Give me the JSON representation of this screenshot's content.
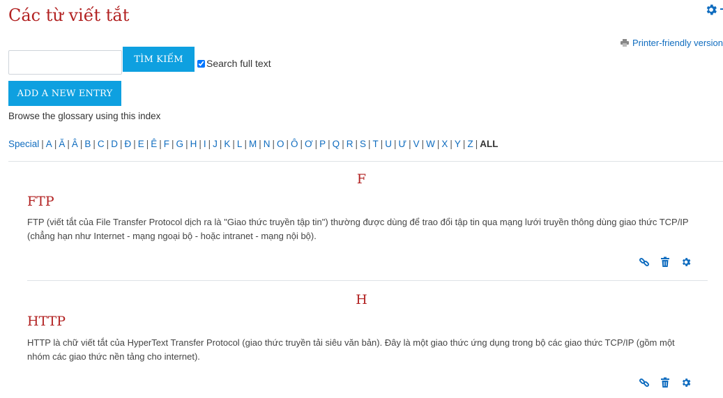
{
  "page": {
    "title": "Các từ viết tắt",
    "printer_link": "Printer-friendly version"
  },
  "search": {
    "input_value": "",
    "button_label": "TÌM KIẾM",
    "fulltext_label": "Search full text",
    "fulltext_checked": true
  },
  "add_entry_label": "ADD A NEW ENTRY",
  "browse_label": "Browse the glossary using this index",
  "alphabet": {
    "special": "Special",
    "letters": [
      "A",
      "Ă",
      "Â",
      "B",
      "C",
      "D",
      "Đ",
      "E",
      "Ê",
      "F",
      "G",
      "H",
      "I",
      "J",
      "K",
      "L",
      "M",
      "N",
      "O",
      "Ô",
      "Ơ",
      "P",
      "Q",
      "R",
      "S",
      "T",
      "U",
      "Ư",
      "V",
      "W",
      "X",
      "Y",
      "Z"
    ],
    "all": "ALL"
  },
  "sections": [
    {
      "letter": "F",
      "entry": {
        "term": "FTP",
        "definition": "FTP (viết tắt của File Transfer Protocol dịch ra là \"Giao thức truyền tập tin\") thường được dùng để trao đổi tập tin qua mạng lưới truyền thông dùng giao thức TCP/IP (chẳng hạn như Internet - mạng ngoại bộ - hoặc intranet - mạng nội bộ)."
      }
    },
    {
      "letter": "H",
      "entry": {
        "term": "HTTP",
        "definition": "HTTP là chữ viết tắt của HyperText Transfer Protocol (giao thức truyền tải siêu văn bản). Đây là một giao thức ứng dụng trong bộ các giao thức TCP/IP (gồm một nhóm các giao thức nền tảng cho internet)."
      }
    }
  ],
  "icons": {
    "page_settings": "gear-icon",
    "printer": "printer-icon",
    "entry_actions": [
      "link-icon",
      "trash-icon",
      "gear-icon"
    ]
  },
  "colors": {
    "accent": "#0ea0e0",
    "link": "#0f6cbf",
    "heading": "#b22222"
  }
}
